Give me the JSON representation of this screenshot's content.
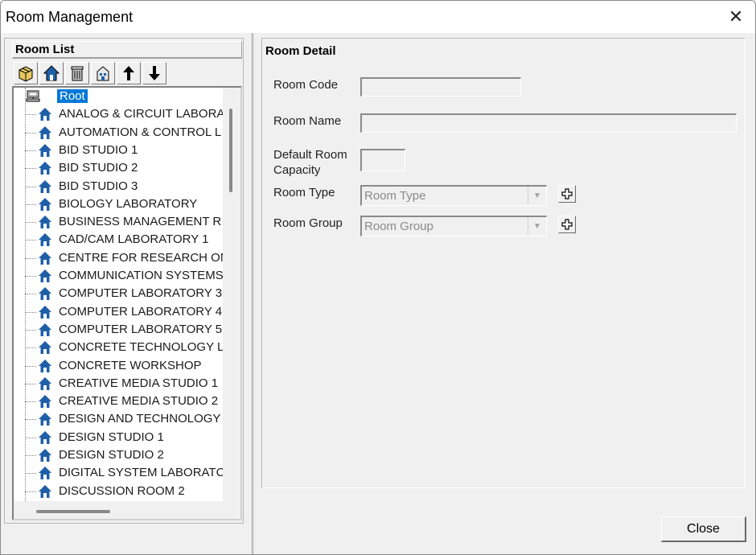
{
  "window": {
    "title": "Room Management",
    "close_glyph": "✕"
  },
  "room_list": {
    "header": "Room List",
    "toolbar": [
      {
        "name": "add-room-button",
        "icon": "package-icon"
      },
      {
        "name": "edit-room-button",
        "icon": "house-icon"
      },
      {
        "name": "delete-room-button",
        "icon": "trash-icon"
      },
      {
        "name": "find-room-button",
        "icon": "building-icon"
      },
      {
        "name": "move-up-button",
        "icon": "arrow-up-icon"
      },
      {
        "name": "move-down-button",
        "icon": "arrow-down-icon"
      }
    ],
    "root": "Root",
    "items": [
      "ANALOG & CIRCUIT LABORA",
      "AUTOMATION & CONTROL L",
      "BID STUDIO 1",
      "BID STUDIO 2",
      "BID STUDIO 3",
      "BIOLOGY LABORATORY",
      "BUSINESS MANAGEMENT R",
      "CAD/CAM LABORATORY 1",
      "CENTRE FOR RESEARCH ON",
      "COMMUNICATION SYSTEMS",
      "COMPUTER LABORATORY 3",
      "COMPUTER LABORATORY 4",
      "COMPUTER LABORATORY 5",
      "CONCRETE TECHNOLOGY L",
      "CONCRETE WORKSHOP",
      "CREATIVE MEDIA STUDIO 1",
      "CREATIVE MEDIA STUDIO 2",
      "DESIGN AND TECHNOLOGY",
      "DESIGN STUDIO 1",
      "DESIGN STUDIO 2",
      "DIGITAL SYSTEM LABORATC",
      "DISCUSSION ROOM 2"
    ]
  },
  "room_detail": {
    "header": "Room Detail",
    "room_code_label": "Room Code",
    "room_code_value": "",
    "room_name_label": "Room Name",
    "room_name_value": "",
    "capacity_label_line1": "Default Room",
    "capacity_label_line2": "Capacity",
    "capacity_value": "",
    "room_type_label": "Room Type",
    "room_type_value": "Room Type",
    "room_group_label": "Room Group",
    "room_group_value": "Room Group"
  },
  "footer": {
    "close_label": "Close"
  },
  "colors": {
    "selection": "#0078d7",
    "house": "#1f5fa8"
  }
}
